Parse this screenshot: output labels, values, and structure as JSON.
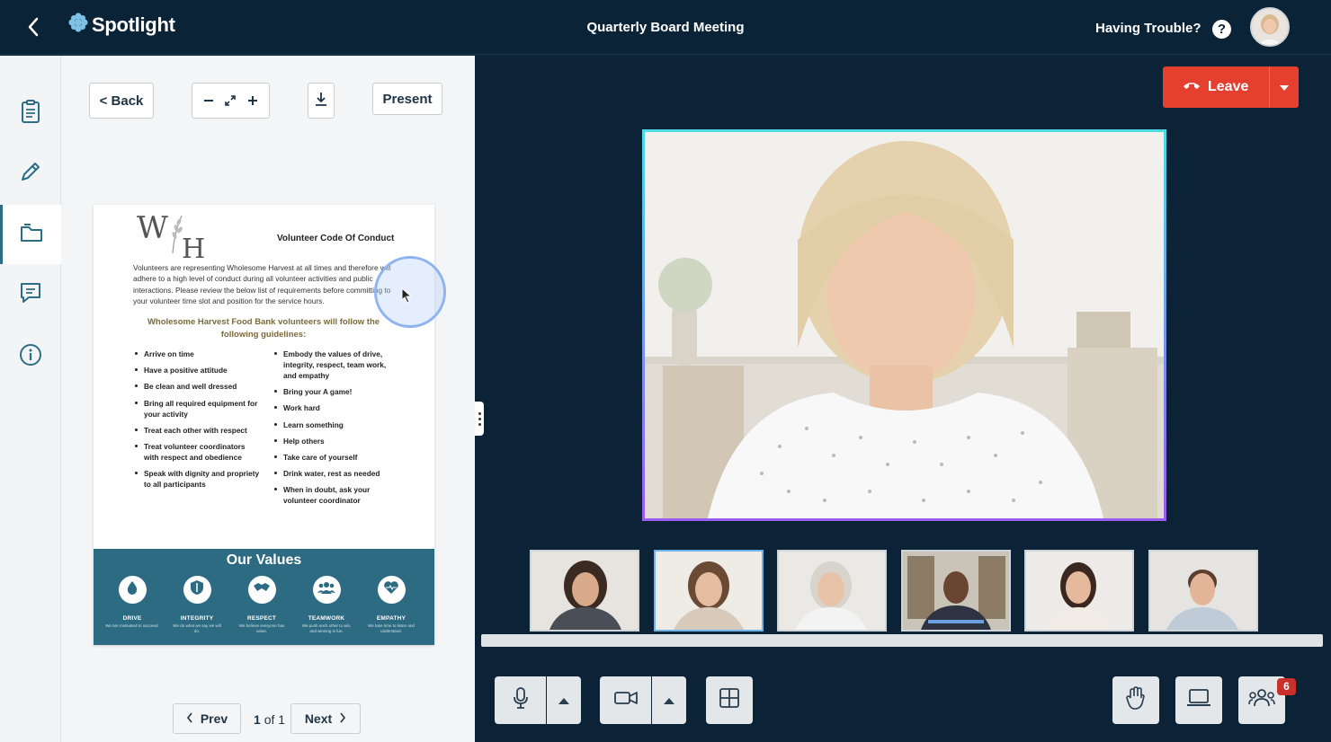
{
  "topbar": {
    "brand": "Spotlight",
    "meeting_title": "Quarterly Board Meeting",
    "help_text": "Having Trouble?",
    "help_icon": "?"
  },
  "toolbar": {
    "back_label": "< Back",
    "present_label": "Present"
  },
  "document": {
    "logo_w": "W",
    "logo_h": "H",
    "heading": "Volunteer Code Of Conduct",
    "intro": "Volunteers are representing Wholesome Harvest at all times and therefore will adhere to a high level of conduct during all volunteer activities and public interactions. Please review the below list of requirements before committing to your volunteer time slot and position for the service hours.",
    "subheading": "Wholesome Harvest Food Bank volunteers will follow the following guidelines:",
    "left_items": [
      "Arrive on time",
      "Have a positive attitude",
      "Be clean and well dressed",
      "Bring all required equipment for your activity",
      "Treat each other with respect",
      "Treat volunteer coordinators with respect and obedience",
      "Speak with dignity and propriety to all participants"
    ],
    "right_items": [
      "Embody the values of drive, integrity, respect, team work, and empathy",
      "Bring your A game!",
      "Work hard",
      "Learn something",
      "Help others",
      "Take care of yourself",
      "Drink water, rest as needed",
      "When in doubt, ask your volunteer coordinator"
    ],
    "values_title": "Our Values",
    "values": [
      {
        "name": "DRIVE",
        "desc": "We are motivated to succeed.",
        "icon": "drop-icon"
      },
      {
        "name": "INTEGRITY",
        "desc": "We do what we say we will do.",
        "icon": "shield-icon"
      },
      {
        "name": "RESPECT",
        "desc": "We believe everyone has value.",
        "icon": "handshake-icon"
      },
      {
        "name": "TEAMWORK",
        "desc": "We push each other to win, and winning is fun.",
        "icon": "team-icon"
      },
      {
        "name": "EMPATHY",
        "desc": "We take time to listen and understand.",
        "icon": "heart-icon"
      }
    ]
  },
  "pager": {
    "prev_label": "Prev",
    "next_label": "Next",
    "current": "1",
    "of": "of",
    "total": "1"
  },
  "video": {
    "leave_label": "Leave",
    "participant_count": "6"
  },
  "colors": {
    "background": "#0c2236",
    "accent_teal": "#2c6b82",
    "leave_red": "#e5402f",
    "highlight_border_top": "#4ddbe6",
    "highlight_border_bottom": "#9b5cf0",
    "badge_red": "#c9302c"
  }
}
